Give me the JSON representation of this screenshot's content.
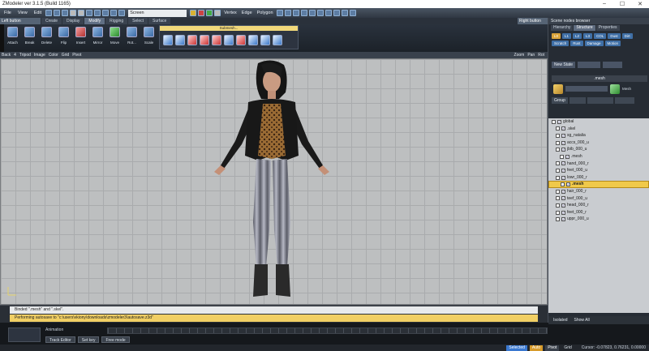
{
  "window": {
    "title": "ZModeler ver 3.1.5 (Build 1165)"
  },
  "menu": {
    "items": [
      "File",
      "View",
      "Edit"
    ]
  },
  "toolbar": {
    "screen": "Screen",
    "selectors": [
      "Vertex",
      "Edge",
      "Polygon"
    ]
  },
  "ribbon": {
    "left_button": "Left button",
    "tabs": [
      "Create",
      "Display",
      "Modify",
      "Rigging",
      "Select",
      "Surface"
    ],
    "active_tab": "Modify",
    "right_button": "Right button"
  },
  "tools": [
    "Attach",
    "Break",
    "Delete",
    "Flip",
    "Insert",
    "Mirror",
    "Move",
    "Rot...",
    "Scale"
  ],
  "subpanel": {
    "title": "Submesh..."
  },
  "viewport_bar": {
    "items": [
      "Back",
      "4",
      "Tripod",
      "Image",
      "Color",
      "Grid",
      "Pivot"
    ],
    "right": [
      "Zoom",
      "Pan",
      "Rot"
    ]
  },
  "log": {
    "lines": [
      "Binded \".mesh\" and \".skel\".",
      "Performing autosave to \"c:\\users\\vkiony\\downloads\\zmodeler3\\autosave.z3d\""
    ]
  },
  "animation": {
    "label": "Animation",
    "track_editor": "Track Editor",
    "set_key": "Set key",
    "free_mode": "Free mode"
  },
  "status": {
    "selected": "Selected",
    "auto": "Auto",
    "pivot": "Pivot",
    "grid": "Grid",
    "cursor": "Cursor: -0.07823, 0.76231, 0.00000"
  },
  "sidebar": {
    "title": "Scene nodes browser",
    "tabs": [
      "Hierarchy",
      "Structure",
      "Properties"
    ],
    "chips_row1": [
      "L0",
      "L1",
      "L2",
      "L3",
      "COL",
      "Dust",
      "Dirt"
    ],
    "chips_row2": [
      "Scratch",
      "Rust",
      "Damage",
      "Motion"
    ],
    "new_state": "New State",
    "mesh_header": ".mesh",
    "mesh_label": "Mesh",
    "group": "Group",
    "footer": {
      "isolated": "Isolated",
      "show_all": "Show All"
    }
  },
  "tree": [
    {
      "name": "global",
      "level": 0,
      "sel": false
    },
    {
      "name": ".skel",
      "level": 1,
      "sel": false
    },
    {
      "name": "sg_natalia",
      "level": 1,
      "sel": false
    },
    {
      "name": "accs_000_u",
      "level": 1,
      "sel": false
    },
    {
      "name": "jbib_000_u",
      "level": 1,
      "sel": false
    },
    {
      "name": ".mesh",
      "level": 2,
      "sel": false
    },
    {
      "name": "hand_000_r",
      "level": 1,
      "sel": false
    },
    {
      "name": "feet_000_u",
      "level": 1,
      "sel": false
    },
    {
      "name": "lowr_000_r",
      "level": 1,
      "sel": false
    },
    {
      "name": ".mesh",
      "level": 2,
      "sel": true
    },
    {
      "name": "hair_000_r",
      "level": 1,
      "sel": false
    },
    {
      "name": "teef_000_u",
      "level": 1,
      "sel": false
    },
    {
      "name": "head_000_r",
      "level": 1,
      "sel": false
    },
    {
      "name": "feet_000_r",
      "level": 1,
      "sel": false
    },
    {
      "name": "uppr_000_u",
      "level": 1,
      "sel": false
    }
  ]
}
